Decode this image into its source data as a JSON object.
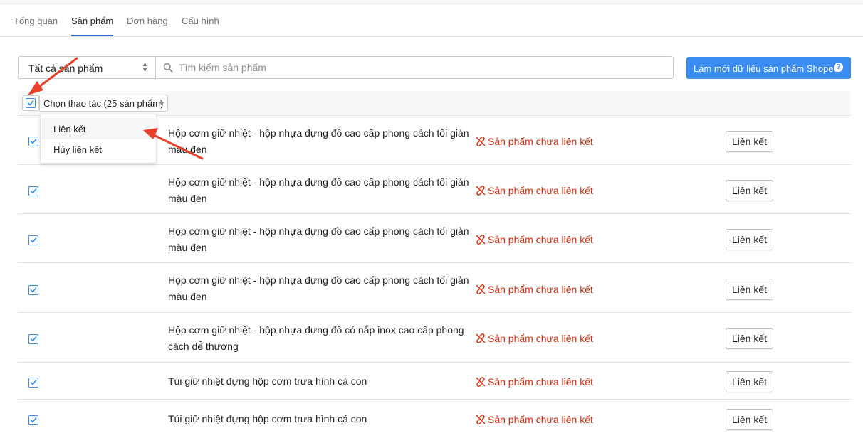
{
  "tabs": [
    {
      "label": "Tổng quan",
      "active": false
    },
    {
      "label": "Sản phẩm",
      "active": true
    },
    {
      "label": "Đơn hàng",
      "active": false
    },
    {
      "label": "Cấu hình",
      "active": false
    }
  ],
  "filter": {
    "selected": "Tất cả sản phẩm"
  },
  "search": {
    "placeholder": "Tìm kiếm sản phẩm",
    "value": ""
  },
  "refresh_button": {
    "label": "Làm mới dữ liệu sản phẩm Shopee",
    "help_icon": "question-circle-icon"
  },
  "bulk": {
    "checked": true,
    "action_label": "Chọn thao tác (25 sản phẩm)"
  },
  "dropdown": {
    "items": [
      "Liên kết",
      "Hủy liên kết"
    ]
  },
  "rows": [
    {
      "checked": true,
      "name": "Hộp cơm giữ nhiệt - hộp nhựa đựng đồ cao cấp phong cách tối giản màu đen",
      "status": "Sản phẩm chưa liên kết",
      "action": "Liên kết"
    },
    {
      "checked": true,
      "name": "Hộp cơm giữ nhiệt - hộp nhựa đựng đồ cao cấp phong cách tối giản màu đen",
      "status": "Sản phẩm chưa liên kết",
      "action": "Liên kết"
    },
    {
      "checked": true,
      "name": "Hộp cơm giữ nhiệt - hộp nhựa đựng đồ cao cấp phong cách tối giản màu đen",
      "status": "Sản phẩm chưa liên kết",
      "action": "Liên kết"
    },
    {
      "checked": true,
      "name": "Hộp cơm giữ nhiệt - hộp nhựa đựng đồ cao cấp phong cách tối giản màu đen",
      "status": "Sản phẩm chưa liên kết",
      "action": "Liên kết"
    },
    {
      "checked": true,
      "name": "Hộp cơm giữ nhiệt - hộp nhựa đựng đồ có nắp inox cao cấp phong cách dễ thương",
      "status": "Sản phẩm chưa liên kết",
      "action": "Liên kết"
    },
    {
      "checked": true,
      "name": "Túi giữ nhiệt đựng hộp cơm trưa hình cá con",
      "status": "Sản phẩm chưa liên kết",
      "action": "Liên kết"
    },
    {
      "checked": true,
      "name": "Túi giữ nhiệt đựng hộp cơm trưa hình cá con",
      "status": "Sản phẩm chưa liên kết",
      "action": "Liên kết"
    }
  ],
  "colors": {
    "accent": "#3b8cf0",
    "status_error": "#d72c0d",
    "annotation_arrow": "#e8412c"
  }
}
